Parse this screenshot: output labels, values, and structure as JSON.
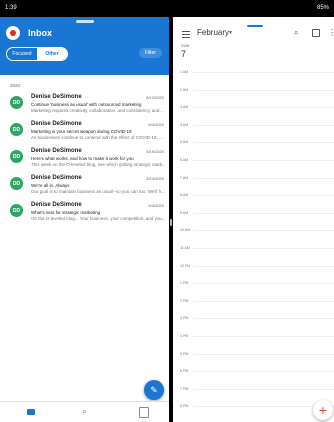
{
  "status_bar": {
    "time": "1:39",
    "battery": "85%"
  },
  "mail": {
    "title": "Inbox",
    "tabs": [
      {
        "label": "Focused"
      },
      {
        "label": "Other"
      }
    ],
    "filter_label": "Filter",
    "year": "2020",
    "messages": [
      {
        "initials": "DD",
        "sender": "Denise DeSimone",
        "date": "6/12/2020",
        "subject": "Continue 'business as usual' with outsourced marketing",
        "preview": "Marketing requires creativity, collaboration, and consistency, and..."
      },
      {
        "initials": "DD",
        "sender": "Denise DeSimone",
        "date": "6/4/2020",
        "subject": "Marketing is your secret weapon during COVID-19",
        "preview": "As businesses continue to contend with the effect of COVID-19, ..."
      },
      {
        "initials": "DD",
        "sender": "Denise DeSimone",
        "date": "5/19/2020",
        "subject": "Here's what works, and how to make it work for you",
        "preview": "This week on the O-leveled blog, see which getting strategic mark..."
      },
      {
        "initials": "DD",
        "sender": "Denise DeSimone",
        "date": "5/14/2020",
        "subject": "We're all in. Always",
        "preview": "Our goal is to maintain business as usual--so you can too. We'll h..."
      },
      {
        "initials": "DD",
        "sender": "Denise DeSimone",
        "date": "5/4/2020",
        "subject": "What's next for strategic marketing",
        "preview": "On the O-leveled blog... Your business, your competition, and you..."
      }
    ]
  },
  "calendar": {
    "month": "February",
    "day_of_week": "SUN",
    "day_number": "7",
    "hours": [
      "1 AM",
      "2 AM",
      "3 AM",
      "4 AM",
      "5 AM",
      "6 AM",
      "7 AM",
      "8 AM",
      "9 AM",
      "10 AM",
      "11 AM",
      "12 PM",
      "1 PM",
      "2 PM",
      "3 PM",
      "4 PM",
      "5 PM",
      "6 PM",
      "7 PM",
      "8 PM",
      "9 PM"
    ]
  }
}
